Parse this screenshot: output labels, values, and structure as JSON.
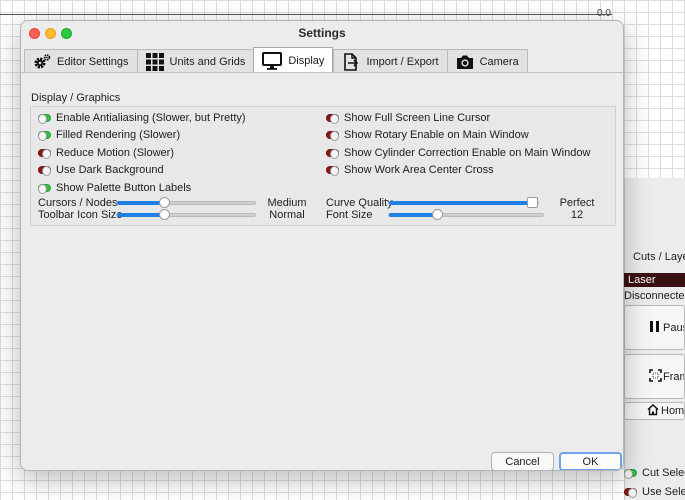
{
  "background": {
    "axis_label": "0.0"
  },
  "side_panel": {
    "cuts_layers": "Cuts / Layers",
    "laser": "Laser",
    "status": "Disconnected",
    "pause": "Pause",
    "frame": "Frame",
    "home": "Home",
    "cut_selected": "Cut Selected",
    "cut_selected_on": true,
    "use_selection": "Use Selection",
    "use_selection_on": false
  },
  "window": {
    "title": "Settings",
    "tabs": [
      {
        "label": "Editor Settings",
        "icon": "gear-icon",
        "active": false
      },
      {
        "label": "Units and Grids",
        "icon": "grid-icon",
        "active": false
      },
      {
        "label": "Display",
        "icon": "monitor-icon",
        "active": true
      },
      {
        "label": "Import / Export",
        "icon": "import-export-icon",
        "active": false
      },
      {
        "label": "Camera",
        "icon": "camera-icon",
        "active": false
      }
    ],
    "section_label": "Display / Graphics",
    "left_options": [
      {
        "label": "Enable Antialiasing (Slower, but Pretty)",
        "on": true
      },
      {
        "label": "Filled Rendering (Slower)",
        "on": true
      },
      {
        "label": "Reduce Motion (Slower)",
        "on": false
      },
      {
        "label": "Use Dark Background",
        "on": false
      },
      {
        "label": "Show Palette Button Labels",
        "on": true
      }
    ],
    "right_options": [
      {
        "label": "Show Full Screen Line Cursor",
        "on": false
      },
      {
        "label": "Show Rotary Enable on Main Window",
        "on": false
      },
      {
        "label": "Show Cylinder Correction Enable on Main Window",
        "on": false
      },
      {
        "label": "Show Work Area Center Cross",
        "on": false
      }
    ],
    "sliders": [
      {
        "label": "Cursors / Nodes",
        "value": "Medium",
        "fraction": 0.34
      },
      {
        "label": "Toolbar Icon Size",
        "value": "Normal",
        "fraction": 0.34
      },
      {
        "label": "Curve Quality",
        "value": "Perfect",
        "fraction": 1.0
      },
      {
        "label": "Font Size",
        "value": "12",
        "fraction": 0.31
      }
    ],
    "buttons": {
      "cancel": "Cancel",
      "ok": "OK"
    },
    "colors": {
      "toggle_on": "#31c045",
      "toggle_off": "#8c1414",
      "slider_fill": "#1f7fe5",
      "focus_ring": "#6ea3e9"
    }
  }
}
